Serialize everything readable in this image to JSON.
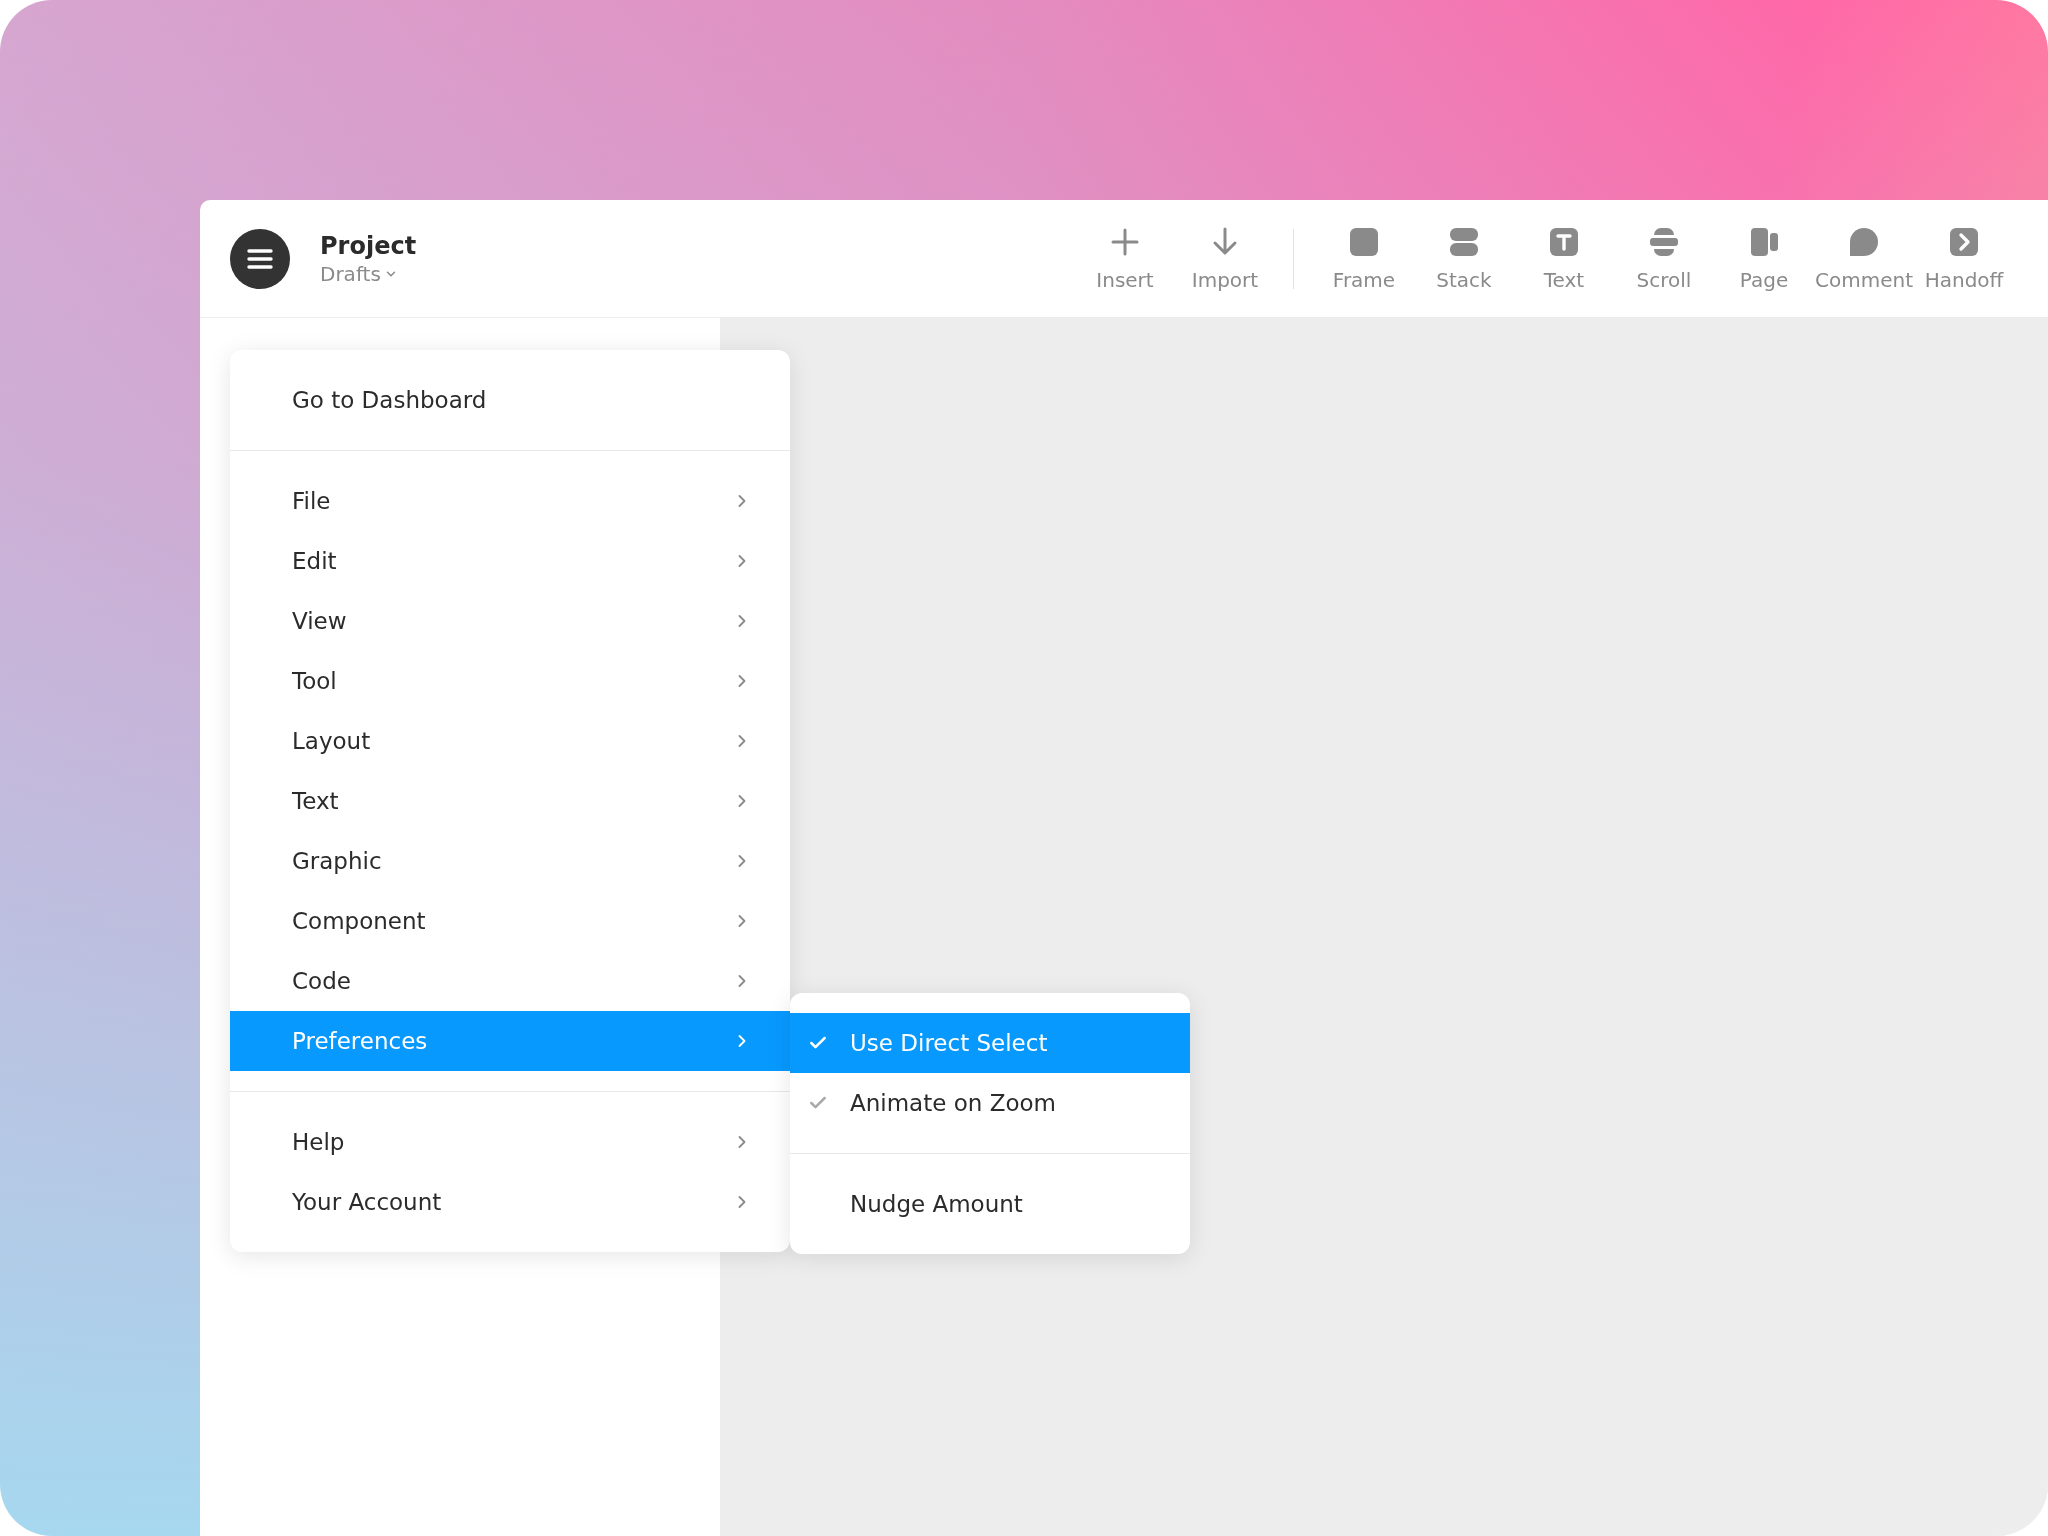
{
  "header": {
    "project_title": "Project",
    "location": "Drafts"
  },
  "toolbar": {
    "groups": [
      {
        "items": [
          {
            "label": "Insert",
            "kind": "plus"
          },
          {
            "label": "Import",
            "kind": "arrow"
          }
        ]
      },
      {
        "items": [
          {
            "label": "Frame",
            "kind": "frame"
          },
          {
            "label": "Stack",
            "kind": "stack"
          },
          {
            "label": "Text",
            "kind": "text"
          },
          {
            "label": "Scroll",
            "kind": "scroll"
          },
          {
            "label": "Page",
            "kind": "page"
          },
          {
            "label": "Comment",
            "kind": "comment"
          },
          {
            "label": "Handoff",
            "kind": "handoff"
          }
        ]
      }
    ]
  },
  "main_menu": {
    "sections": [
      {
        "items": [
          {
            "label": "Go to Dashboard",
            "has_submenu": false,
            "selected": false
          }
        ]
      },
      {
        "items": [
          {
            "label": "File",
            "has_submenu": true,
            "selected": false
          },
          {
            "label": "Edit",
            "has_submenu": true,
            "selected": false
          },
          {
            "label": "View",
            "has_submenu": true,
            "selected": false
          },
          {
            "label": "Tool",
            "has_submenu": true,
            "selected": false
          },
          {
            "label": "Layout",
            "has_submenu": true,
            "selected": false
          },
          {
            "label": "Text",
            "has_submenu": true,
            "selected": false
          },
          {
            "label": "Graphic",
            "has_submenu": true,
            "selected": false
          },
          {
            "label": "Component",
            "has_submenu": true,
            "selected": false
          },
          {
            "label": "Code",
            "has_submenu": true,
            "selected": false
          },
          {
            "label": "Preferences",
            "has_submenu": true,
            "selected": true
          }
        ]
      },
      {
        "items": [
          {
            "label": "Help",
            "has_submenu": true,
            "selected": false
          },
          {
            "label": "Your Account",
            "has_submenu": true,
            "selected": false
          }
        ]
      }
    ]
  },
  "submenu": {
    "sections": [
      {
        "items": [
          {
            "label": "Use Direct Select",
            "checked": true,
            "selected": true
          },
          {
            "label": "Animate on Zoom",
            "checked": true,
            "selected": false
          }
        ]
      },
      {
        "items": [
          {
            "label": "Nudge Amount",
            "checked": false,
            "selected": false
          }
        ]
      }
    ]
  }
}
